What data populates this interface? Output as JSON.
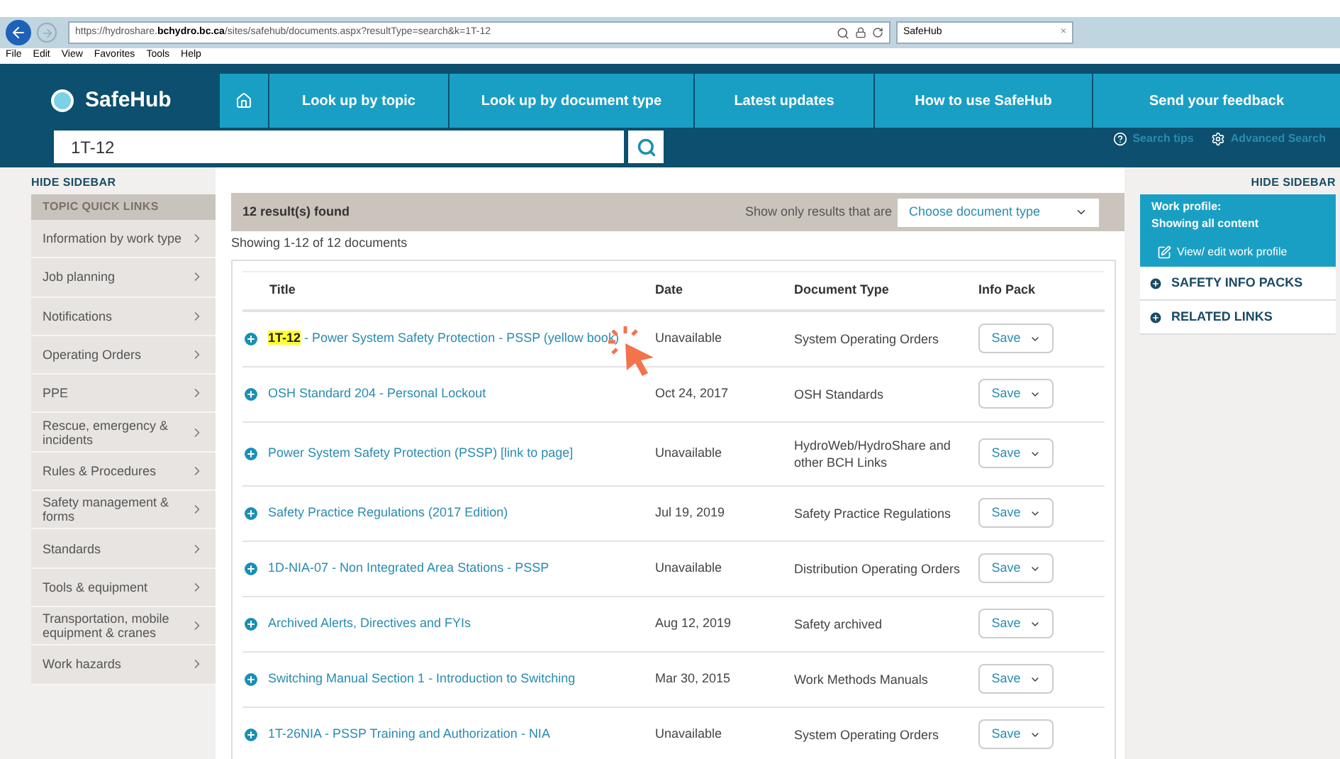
{
  "browser": {
    "url_host_prefix": "https://hydroshare.",
    "url_host": "bchydro.bc.ca",
    "url_path": "/sites/safehub/documents.aspx?resultType=search&k=1T-12",
    "tab_title": "SafeHub",
    "tab_close": "×",
    "menu": [
      "File",
      "Edit",
      "View",
      "Favorites",
      "Tools",
      "Help"
    ]
  },
  "header": {
    "logo": "SafeHub",
    "nav": [
      "Look up by topic",
      "Look up by document type",
      "Latest updates",
      "How to use SafeHub",
      "Send your feedback"
    ],
    "search_value": "1T-12",
    "links": [
      "Search tips",
      "Advanced Search"
    ]
  },
  "left_sidebar": {
    "hide": "HIDE SIDEBAR",
    "heading": "TOPIC QUICK LINKS",
    "items": [
      "Information by work type",
      "Job planning",
      "Notifications",
      "Operating Orders",
      "PPE",
      "Rescue, emergency & incidents",
      "Rules & Procedures",
      "Safety management & forms",
      "Standards",
      "Tools & equipment",
      "Transportation, mobile equipment & cranes",
      "Work hazards"
    ]
  },
  "results": {
    "count": "12 result(s) found",
    "filter_label": "Show only results that are",
    "filter_placeholder": "Choose document type",
    "showing": "Showing 1-12 of 12 documents",
    "columns": [
      "Title",
      "Date",
      "Document Type",
      "Info Pack"
    ],
    "rows": [
      {
        "match": "1T-12",
        "title": " - Power System Safety Protection - PSSP (yellow book)",
        "date": "Unavailable",
        "type": "System Operating Orders",
        "action": "Save"
      },
      {
        "title": "OSH Standard 204 - Personal Lockout",
        "date": "Oct 24, 2017",
        "type": "OSH Standards",
        "action": "Save"
      },
      {
        "title": "Power System Safety Protection (PSSP) [link to page]",
        "date": "Unavailable",
        "type": "HydroWeb/HydroShare and other BCH Links",
        "action": "Save"
      },
      {
        "title": "Safety Practice Regulations (2017 Edition)",
        "date": "Jul 19, 2019",
        "type": "Safety Practice Regulations",
        "action": "Save"
      },
      {
        "title": "1D-NIA-07 - Non Integrated Area Stations - PSSP",
        "date": "Unavailable",
        "type": "Distribution Operating Orders",
        "action": "Save"
      },
      {
        "title": "Archived Alerts, Directives and FYIs",
        "date": "Aug 12, 2019",
        "type": "Safety archived",
        "action": "Save"
      },
      {
        "title": "Switching Manual Section 1 - Introduction to Switching",
        "date": "Mar 30, 2015",
        "type": "Work Methods Manuals",
        "action": "Save"
      },
      {
        "title": "1T-26NIA - PSSP Training and Authorization - NIA",
        "date": "Unavailable",
        "type": "System Operating Orders",
        "action": "Save"
      }
    ]
  },
  "right_sidebar": {
    "hide": "HIDE SIDEBAR",
    "profile_title": "Work profile:",
    "profile_status": "Showing all content",
    "profile_link": "View/ edit work profile",
    "sections": [
      "SAFETY INFO PACKS",
      "RELATED LINKS"
    ]
  }
}
